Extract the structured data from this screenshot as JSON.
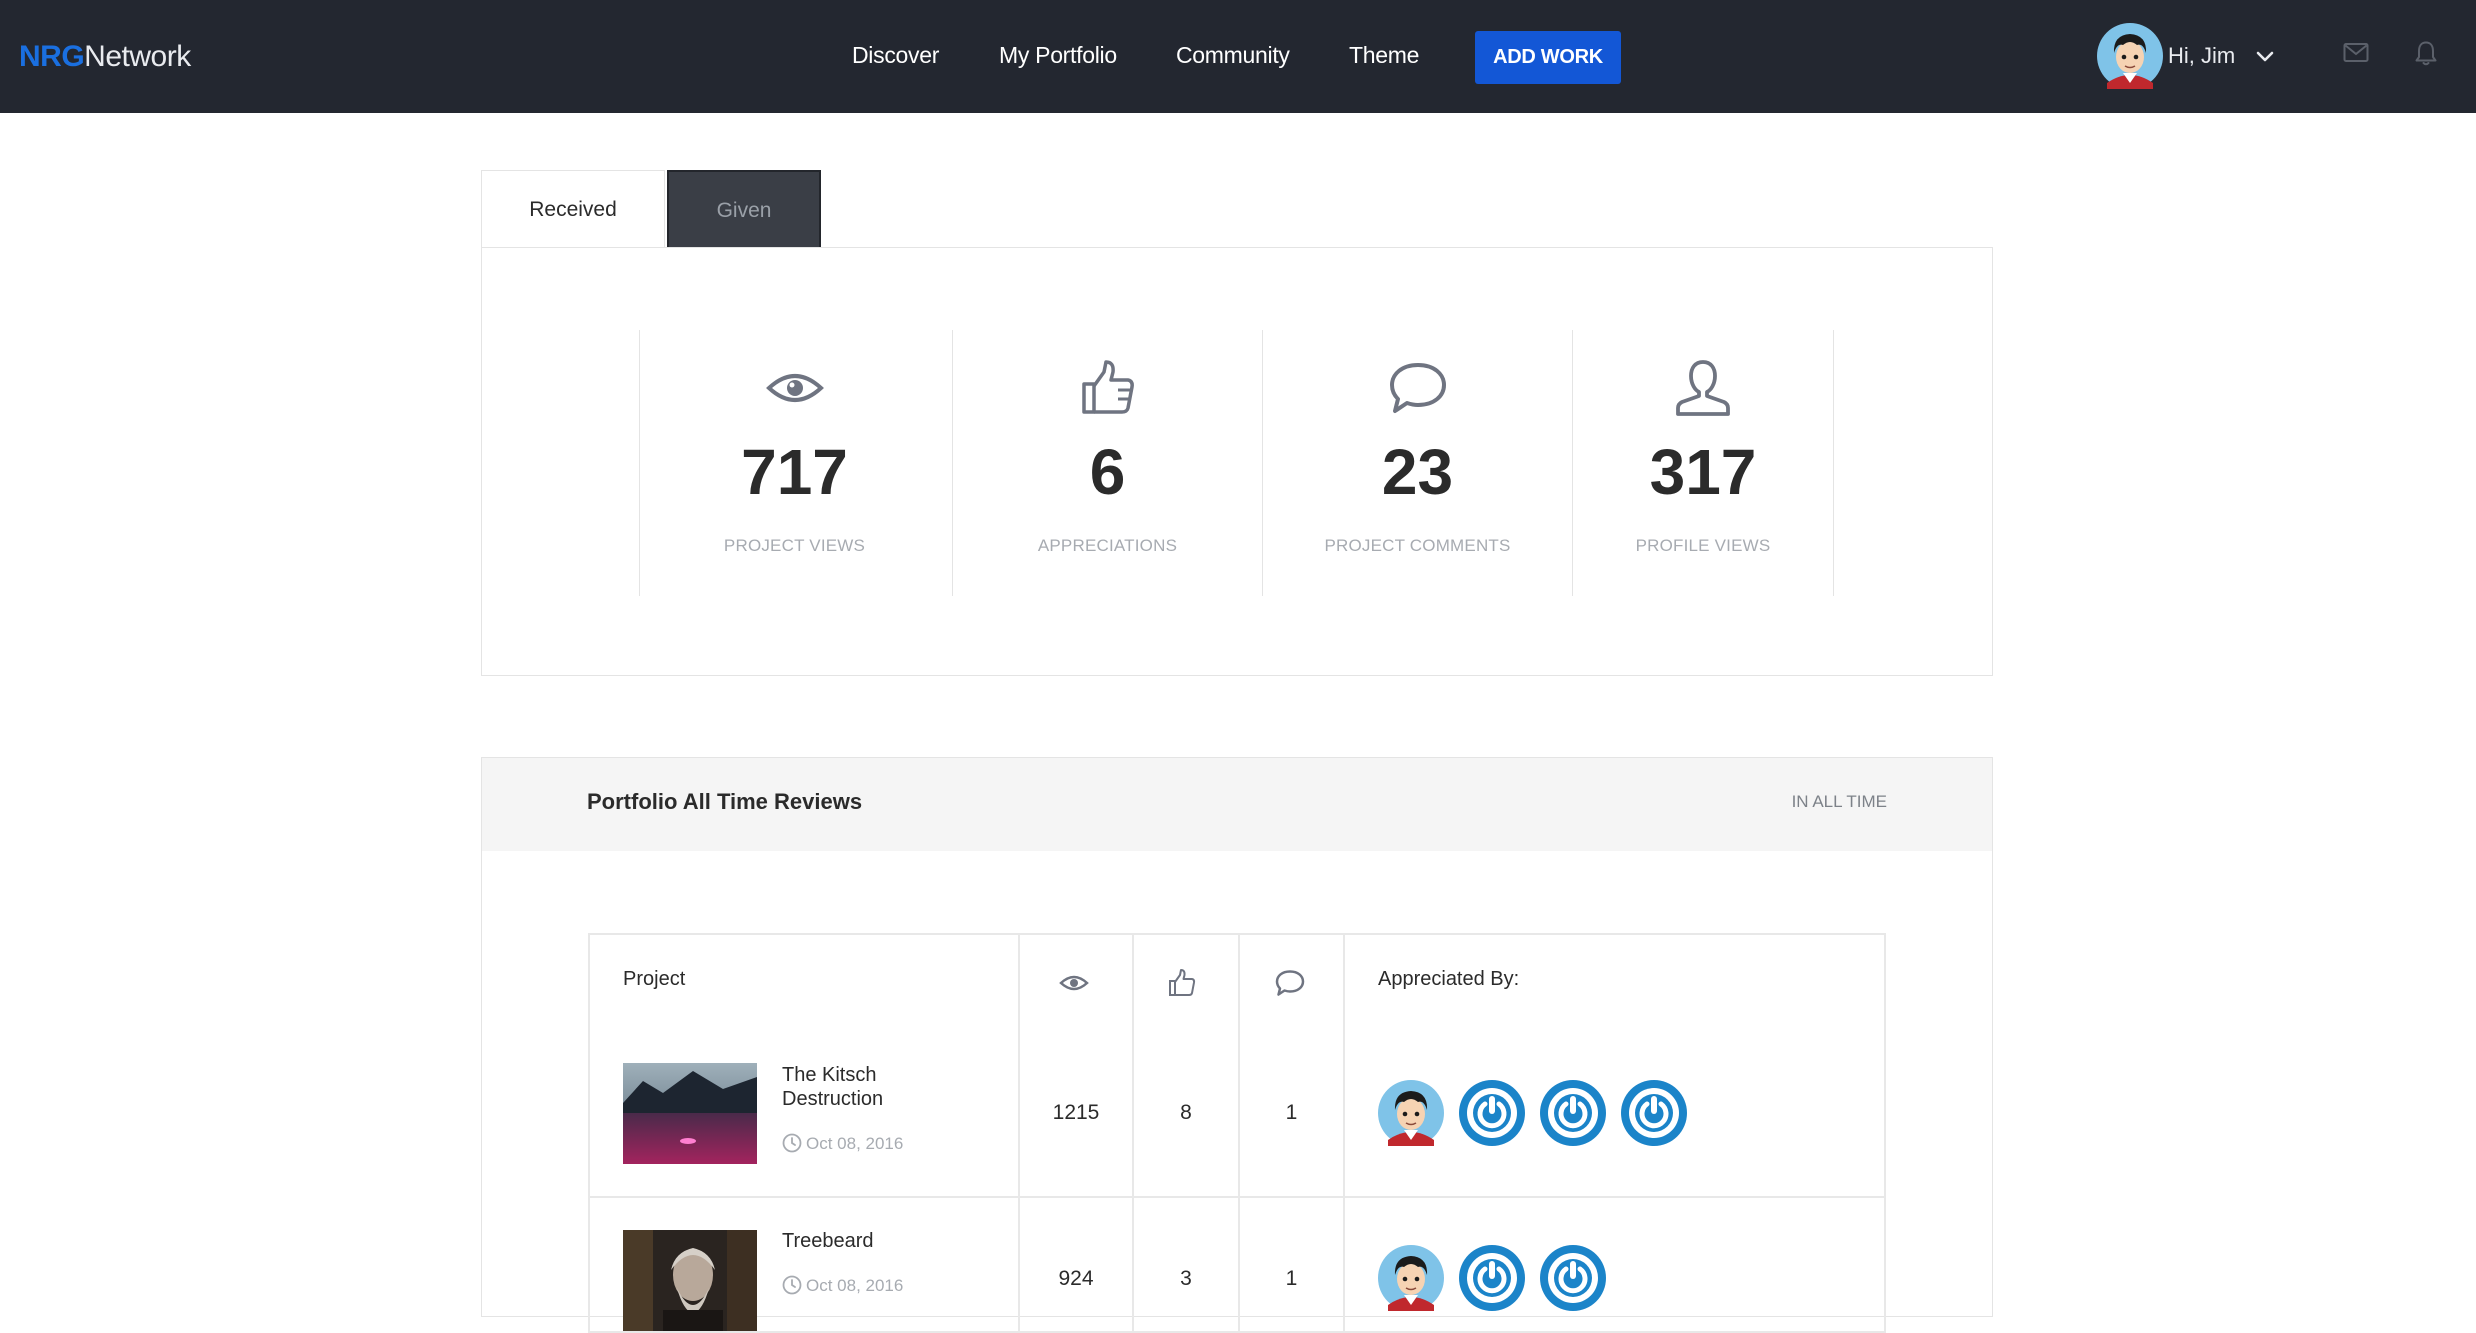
{
  "brand": {
    "prefix": "NRG",
    "suffix": "Network"
  },
  "nav": {
    "links": [
      "Discover",
      "My Portfolio",
      "Community",
      "Theme"
    ],
    "add_work": "ADD WORK",
    "user_greeting": "Hi, Jim",
    "icons": [
      "mail-icon",
      "bell-icon",
      "chevron-down-icon"
    ]
  },
  "tabs": [
    "Received",
    "Given"
  ],
  "active_tab": "Received",
  "stats": [
    {
      "icon": "eye-icon",
      "value": "717",
      "label": "PROJECT VIEWS"
    },
    {
      "icon": "thumbs-up-icon",
      "value": "6",
      "label": "APPRECIATIONS"
    },
    {
      "icon": "comment-icon",
      "value": "23",
      "label": "PROJECT COMMENTS"
    },
    {
      "icon": "user-icon",
      "value": "317",
      "label": "PROFILE VIEWS"
    }
  ],
  "reviews": {
    "title": "Portfolio All Time Reviews",
    "filter": "IN ALL TIME",
    "columns": {
      "project": "Project",
      "appreciated_by": "Appreciated By:"
    },
    "rows": [
      {
        "title": "The Kitsch Destruction",
        "date": "Oct 08, 2016",
        "views": "1215",
        "appreciations": "8",
        "comments": "1",
        "appreciators": [
          "avatar",
          "power-icon",
          "power-icon",
          "power-icon"
        ]
      },
      {
        "title": "Treebeard",
        "date": "Oct 08, 2016",
        "views": "924",
        "appreciations": "3",
        "comments": "1",
        "appreciators": [
          "avatar",
          "power-icon",
          "power-icon"
        ]
      }
    ]
  },
  "colors": {
    "nav_bg": "#232730",
    "accent": "#1357d6",
    "brand_blue": "#1a6fe0",
    "power_blue": "#1b84c9"
  }
}
